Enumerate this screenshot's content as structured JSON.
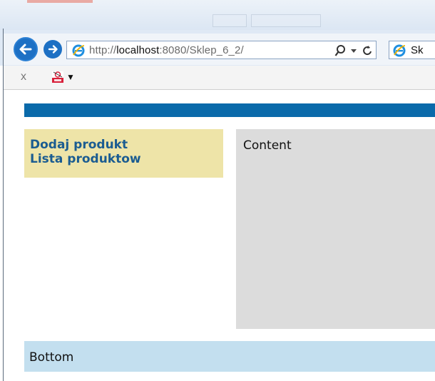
{
  "browser": {
    "url_prefix": "http://",
    "url_host": "localhost",
    "url_path": ":8080/Sklep_6_2/",
    "tab_label": "Sk",
    "command_bar": {
      "close_label": "x"
    }
  },
  "page": {
    "sidebar": {
      "links": [
        "Dodaj produkt",
        "Lista produktow"
      ]
    },
    "content_label": "Content",
    "bottom_label": "Bottom"
  },
  "colors": {
    "header_bar": "#0a6aaa",
    "sidebar_bg": "#eee4a8",
    "sidebar_link": "#1b5c91",
    "content_bg": "#dcdcdc",
    "bottom_bg": "#c3dfef",
    "nav_button": "#1d70c4"
  }
}
